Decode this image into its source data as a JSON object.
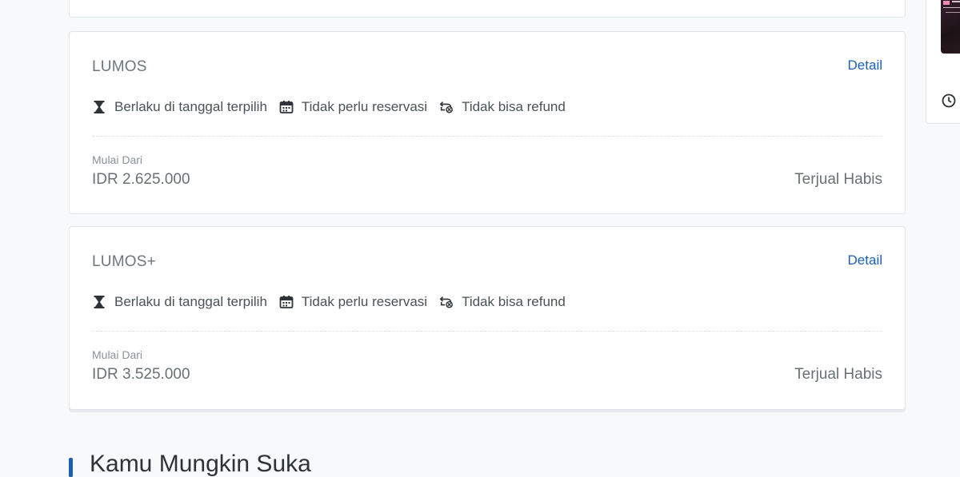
{
  "packages": [
    {
      "name": "LUMOS",
      "detail_label": "Detail",
      "features": [
        {
          "icon": "hourglass-icon",
          "label": "Berlaku di tanggal terpilih"
        },
        {
          "icon": "calendar-icon",
          "label": "Tidak perlu reservasi"
        },
        {
          "icon": "no-refund-icon",
          "label": "Tidak bisa refund"
        }
      ],
      "from_label": "Mulai Dari",
      "price": "IDR 2.625.000",
      "status": "Terjual Habis"
    },
    {
      "name": "LUMOS+",
      "detail_label": "Detail",
      "features": [
        {
          "icon": "hourglass-icon",
          "label": "Berlaku di tanggal terpilih"
        },
        {
          "icon": "calendar-icon",
          "label": "Tidak perlu reservasi"
        },
        {
          "icon": "no-refund-icon",
          "label": "Tidak bisa refund"
        }
      ],
      "from_label": "Mulai Dari",
      "price": "IDR 3.525.000",
      "status": "Terjual Habis"
    }
  ],
  "section": {
    "title": "Kamu Mungkin Suka"
  },
  "colors": {
    "accent": "#1b5fb6",
    "background": "#f7f9fa",
    "card_border": "#e1e5ea",
    "muted_text": "#687176"
  }
}
